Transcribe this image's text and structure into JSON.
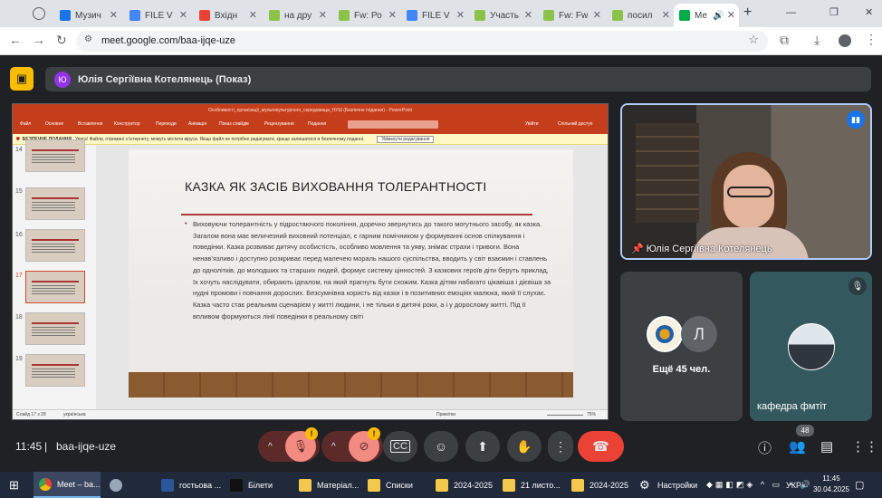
{
  "browser": {
    "tabs": [
      {
        "label": "Музич",
        "color": "#1a73e8"
      },
      {
        "label": "FILE V",
        "color": "#4285f4"
      },
      {
        "label": "Вхідн",
        "color": "#ea4335"
      },
      {
        "label": "на дру",
        "color": "#8bc34a"
      },
      {
        "label": "Fw: Ро",
        "color": "#8bc34a"
      },
      {
        "label": "FILE V",
        "color": "#4285f4"
      },
      {
        "label": "Участь",
        "color": "#8bc34a"
      },
      {
        "label": "Fw: Fw",
        "color": "#8bc34a"
      },
      {
        "label": "посил",
        "color": "#8bc34a"
      },
      {
        "label": "Ме",
        "color": "#00ac47"
      }
    ],
    "new_tab": "+",
    "url": "meet.google.com/baa-ijqe-uze",
    "window_controls": [
      "—",
      "❐",
      "✕"
    ]
  },
  "meet": {
    "presenter_initial": "Ю",
    "presenter_label": "Юлія Сергіївна Котелянець (Показ)",
    "main_tile_name": "Юлія Сергіївна Котелянець",
    "more_initial": "Л",
    "more_participants": "Ещё 45 чел.",
    "kafedra_name": "кафедра фмтіт",
    "time": "11:45",
    "meeting_code": "baa-ijqe-uze",
    "people_count": "48",
    "warn_mark": "!"
  },
  "ppt": {
    "window_title": "Особливості_організації_мультикультурного_середовища_НУШ (Безпечне подання) - PowerPoint",
    "ribbon_tabs": [
      "Файл",
      "Основне",
      "Вставлення",
      "Конструктор",
      "Переходи",
      "Анімація",
      "Показ слайдів",
      "Рецензування",
      "Подання"
    ],
    "ribbon_right": [
      "Увійти",
      "Спільний доступ"
    ],
    "warning_label": "БЕЗПЕЧНЕ ПОДАННЯ",
    "warning_text": "Увага! Файли, отримані з Інтернету, можуть містити віруси. Якщо файл не потрібно редагувати, краще залишатися в безпечному поданні.",
    "warning_button": "Увімкнути редагування",
    "thumb_numbers": [
      "14",
      "15",
      "16",
      "17",
      "18",
      "19"
    ],
    "slide_title": "КАЗКА ЯК ЗАСІБ ВИХОВАННЯ ТОЛЕРАНТНОСТІ",
    "bullet": "•",
    "slide_body": "Виховуючи толерантність у підростаючого покоління, доречно звернутись до такого могутнього засобу, як казка. Загалом вона має величезний виховний потенціал, є гарним помічником у формуванні основ спілкування і поведінки. Казка розвиває дитячу особистість, особливо мовлення та уяву, знімає страхи і тривоги. Вона ненав’язливо і доступно розкриває перед малечею мораль нашого суспільства, вводить у світ взаємин і ставлень до одноліткiв, до молодших та старших людей, формує систему цінностей. З казкових героїв діти беруть приклад, їх хочуть наслідувати, обирають ідеалом, на який прагнуть бути схожим. Казка дітям набагато цікавіша і дієвіша за нудні промови і повчання дорослих. Безсумнівна користь від казки і в позитивних емоціях малюка, який її слухає. Казка часто стає реальним сценарієм у житті людини, і не тільки в дитячі роки, а і у дорослому житті. Під її впливом формуються лінії поведінки в реальному світі",
    "status_slide": "Слайд 17 з 28",
    "status_lang": "українська",
    "status_notes": "Примітки",
    "status_zoom": "75%"
  },
  "taskbar": {
    "items": [
      "Meet – ba...",
      "",
      "гостьова ...",
      "Білети",
      "Матеріал...",
      "Списки",
      "2024-2025",
      "21 листо...",
      "2024-2025",
      "Настройки"
    ],
    "lang": "УКР",
    "time": "11:45",
    "date": "30.04.2025"
  }
}
